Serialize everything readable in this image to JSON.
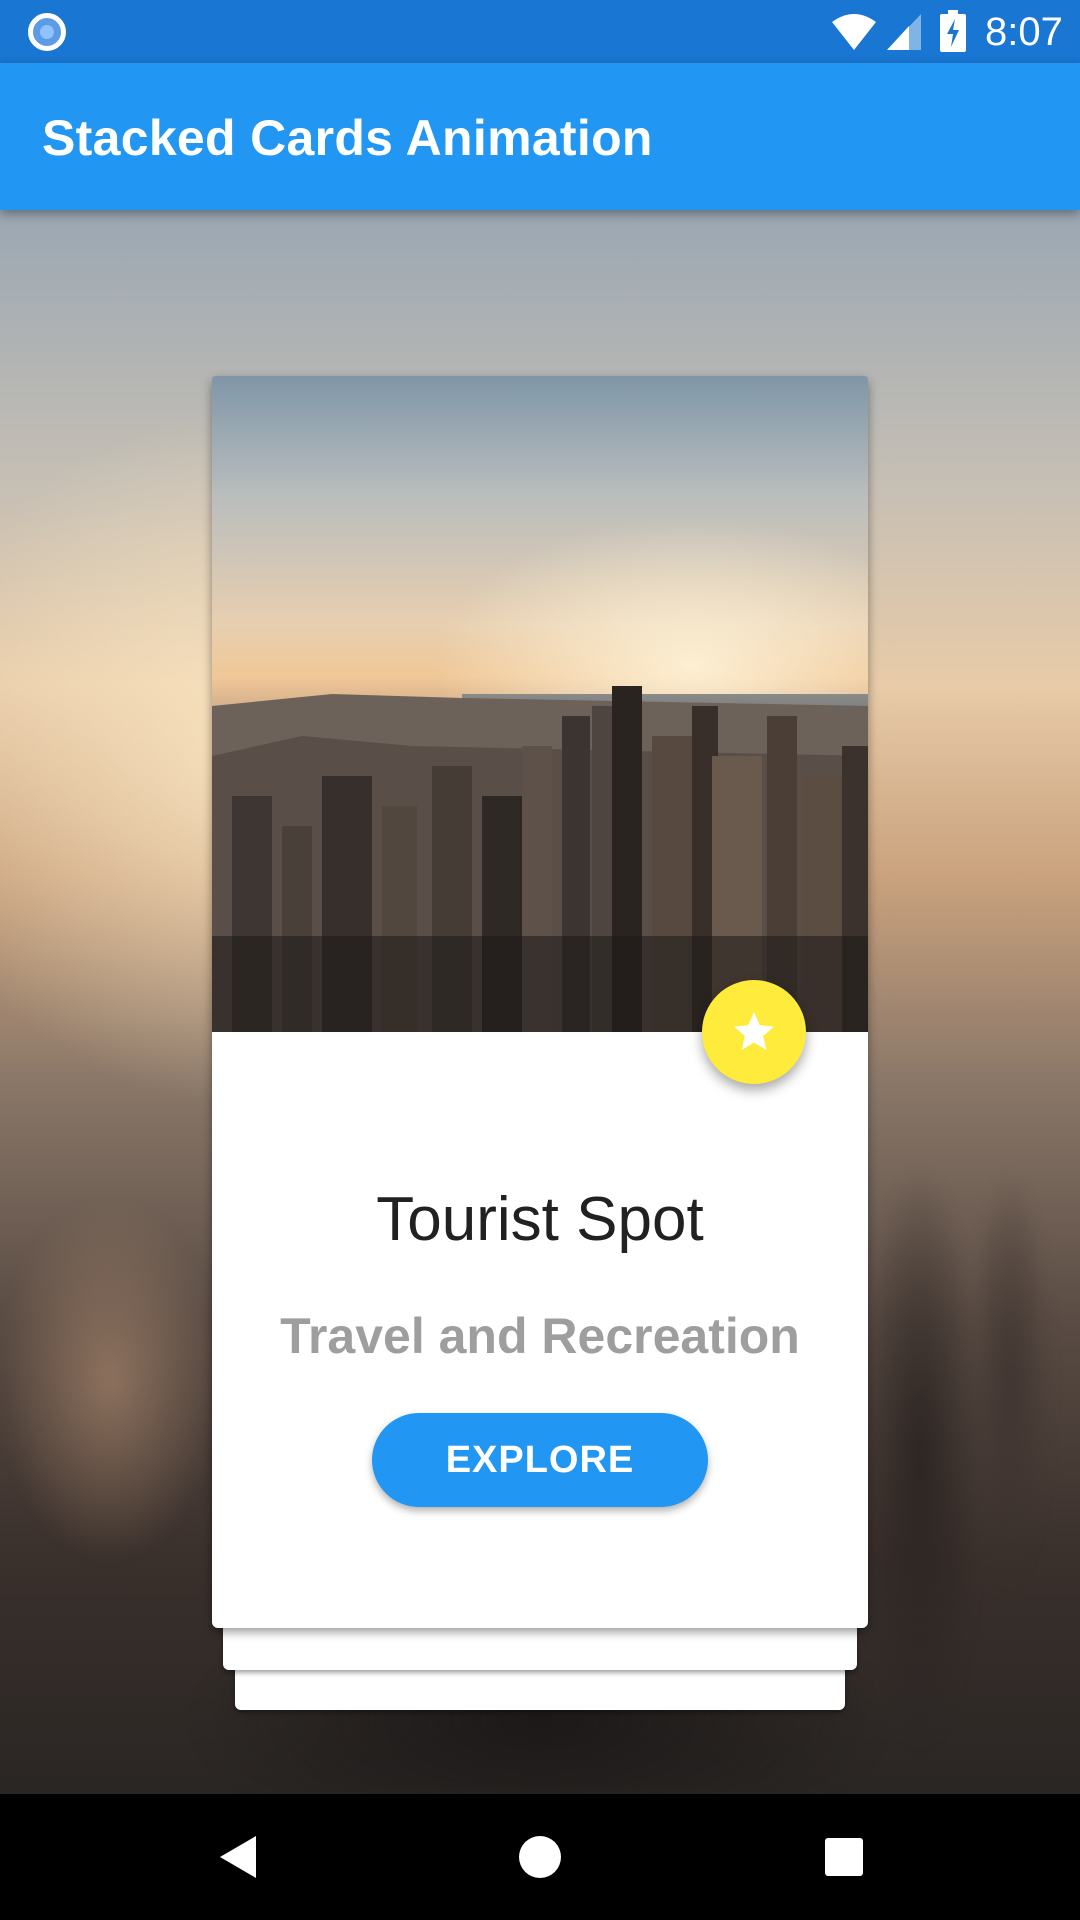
{
  "status_bar": {
    "time": "8:07",
    "left_icon": "notification-circle-icon",
    "icons": [
      "wifi-icon",
      "cell-signal-icon",
      "battery-charging-icon"
    ]
  },
  "app_bar": {
    "title": "Stacked Cards Animation"
  },
  "card": {
    "image": "city-skyline-photo",
    "favorite_icon": "star-icon",
    "title": "Tourist Spot",
    "subtitle": "Travel and Recreation",
    "button_label": "EXPLORE"
  },
  "stack": {
    "card_count": 3
  },
  "nav_bar": {
    "buttons": [
      "back-icon",
      "home-icon",
      "recents-icon"
    ]
  },
  "colors": {
    "status_bar": "#1976D2",
    "app_bar": "#2196F3",
    "accent": "#2196F3",
    "fab": "#FFEB3B",
    "title_text": "#212121",
    "subtitle_text": "#9E9E9E"
  }
}
